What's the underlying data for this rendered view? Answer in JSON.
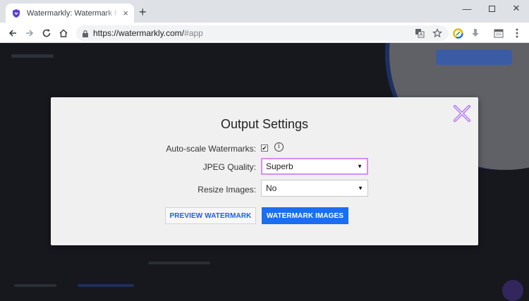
{
  "browser": {
    "tab_title": "Watermarkly: Watermark Photos",
    "tab_close": "×",
    "new_tab": "+",
    "url_host": "https://watermarkly.com/",
    "url_path": "#app",
    "window_controls": {
      "minimize": "—",
      "close": "✕"
    }
  },
  "modal": {
    "title": "Output Settings",
    "auto_scale_label": "Auto-scale Watermarks:",
    "auto_scale_checked": "✔",
    "info_symbol": "i",
    "jpeg_label": "JPEG Quality:",
    "jpeg_value": "Superb",
    "resize_label": "Resize Images:",
    "resize_value": "No",
    "select_arrow": "▼",
    "preview_button": "PREVIEW WATERMARK",
    "watermark_button": "WATERMARK IMAGES"
  },
  "colors": {
    "accent": "#1a6ef0",
    "focus_border": "#d68ef3",
    "close_icon": "#b06cf0",
    "page_overlay": "#16181e"
  },
  "icons": [
    "shield-favicon-icon",
    "back-arrow-icon",
    "forward-arrow-icon",
    "reload-icon",
    "home-icon",
    "lock-icon",
    "translate-icon",
    "star-icon",
    "extension-icon",
    "download-icon",
    "calendar-icon",
    "menu-kebab-icon",
    "close-x-icon",
    "info-icon"
  ]
}
